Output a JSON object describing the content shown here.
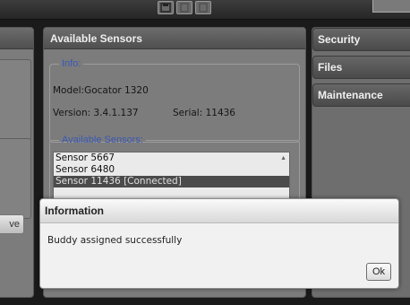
{
  "toolbar": {
    "icons": [
      "save-icon",
      "page-icon",
      "page-icon"
    ]
  },
  "left_panel": {
    "button_label": "ve"
  },
  "sensors_panel": {
    "title": "Available Sensors",
    "info": {
      "legend": "Info:",
      "model": "Model:Gocator 1320",
      "version": "Version: 3.4.1.137",
      "serial": "Serial: 11436"
    },
    "available": {
      "legend": "Available Sensors:",
      "items": [
        "Sensor 5667",
        "Sensor 6480",
        "Sensor 11436 [Connected]"
      ],
      "selected_index": 2
    }
  },
  "side_tabs": [
    "Security",
    "Files",
    "Maintenance"
  ],
  "dialog": {
    "title": "Information",
    "message": "Buddy assigned successfully",
    "ok_label": "Ok"
  },
  "colors": {
    "legend_blue": "#3a58b5",
    "panel_gray": "#7c7c7c",
    "selected_row": "#4b4b4b"
  }
}
